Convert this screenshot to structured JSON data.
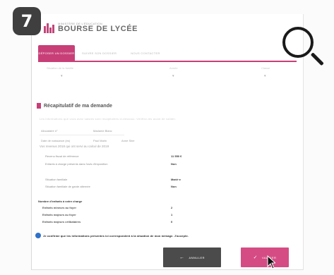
{
  "step_badge": "7",
  "logo": {
    "small": "MINISTÈRE DE L'ÉDUCATION",
    "big": "BOURSE DE LYCÉE"
  },
  "tabs": [
    {
      "label": "DÉPOSER UN DOSSIER",
      "active": true
    },
    {
      "label": "SUIVRE SON DOSSIER",
      "active": false
    },
    {
      "label": "NOUS CONTACTER",
      "active": false
    }
  ],
  "filters": [
    {
      "label": "Situation de la famille"
    },
    {
      "label": "Année"
    },
    {
      "label": "Classe"
    }
  ],
  "section": {
    "title": "Récapitulatif de ma demande"
  },
  "intro": "Les informations que vous avez saisies sont récapitulées ci-dessous. Vérifiez-les avant de valider.",
  "meta": {
    "row1": {
      "label": "Allocataire n°",
      "value": "Madame Blanc"
    },
    "row2": {
      "label": "Date de naissance (es)",
      "v1": "Paul Marin",
      "v2": "Anne Sine"
    }
  },
  "recap": {
    "title": "Vos revenus 2018 qui ont servi au calcul de 2019",
    "lines": [
      {
        "label": "Revenu fiscal de référence",
        "value": "11 550 €"
      },
      {
        "label": "Enfants à charge présents dans l'avis d'imposition",
        "value": "Non"
      },
      {
        "label": "Situation familiale",
        "value": "Marié·e"
      },
      {
        "label": "Situation familiale de garde alternée",
        "value": "Non"
      }
    ]
  },
  "calc": {
    "head": "Nombre d'enfants à votre charge",
    "lines": [
      {
        "label": "Enfants mineurs au foyer",
        "value": "2"
      },
      {
        "label": "Enfants majeurs au foyer",
        "value": "1"
      },
      {
        "label": "Enfants majeurs célibataires",
        "value": "0"
      }
    ]
  },
  "certification": "Je confirme que les informations présentes ici correspondent à la situation de mon ménage. J'accepte.",
  "buttons": {
    "back": "ANNULER",
    "next": "VALIDER"
  },
  "colors": {
    "accent": "#c83f78",
    "button_next": "#d54c84",
    "button_back": "#4b4b4b",
    "badge": "#3f3f3f"
  }
}
